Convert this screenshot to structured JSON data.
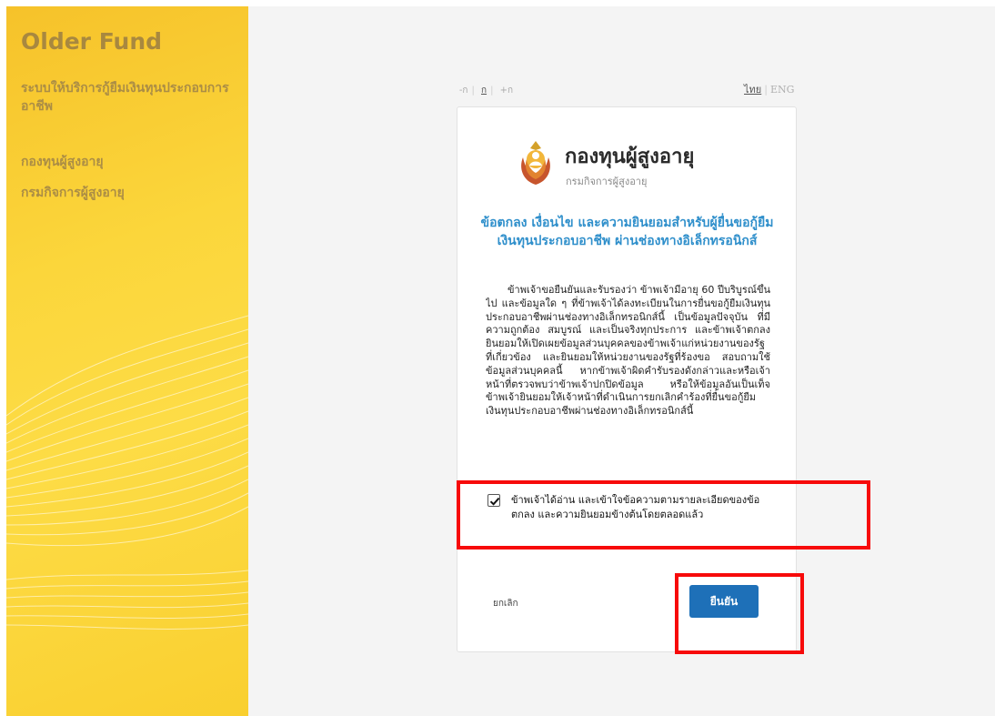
{
  "sidebar": {
    "brand": "Older Fund",
    "system_title": "ระบบให้บริการกู้ยืมเงินทุนประกอบการอาชีพ",
    "links": [
      "กองทุนผู้สูงอายุ",
      "กรมกิจการผู้สูงอายุ"
    ]
  },
  "toolbar": {
    "font_smaller": "-ก",
    "font_normal": "ก",
    "font_larger": "+ก",
    "lang_thai": "ไทย",
    "lang_eng": "ENG"
  },
  "card": {
    "org_name": "กองทุนผู้สูงอายุ",
    "org_sub": "กรมกิจการผู้สูงอายุ",
    "terms_title": "ข้อตกลง เงื่อนไข และความยินยอมสำหรับผู้ยื่นขอกู้ยืมเงินทุนประกอบอาชีพ ผ่านช่องทางอิเล็กทรอนิกส์",
    "terms_body": "ข้าพเจ้าขอยืนยันและรับรองว่า ข้าพเจ้ามีอายุ 60 ปีบริบูรณ์ขึ้นไป และข้อมูลใด ๆ ที่ข้าพเจ้าได้ลงทะเบียนในการยื่นขอกู้ยืมเงินทุนประกอบอาชีพผ่านช่องทางอิเล็กทรอนิกส์นี้ เป็นข้อมูลปัจจุบัน ที่มีความถูกต้อง สมบูรณ์ และเป็นจริงทุกประการ และข้าพเจ้าตกลงยินยอมให้เปิดเผยข้อมูลส่วนบุคคลของข้าพเจ้าแก่หน่วยงานของรัฐที่เกี่ยวข้อง และยินยอมให้หน่วยงานของรัฐที่ร้องขอ สอบถามใช้ข้อมูลส่วนบุคคลนี้ หากข้าพเจ้าผิดคำรับรองดังกล่าวและหรือเจ้าหน้าที่ตรวจพบว่าข้าพเจ้าปกปิดข้อมูล หรือให้ข้อมูลอันเป็นเท็จ ข้าพเจ้ายินยอมให้เจ้าหน้าที่ดำเนินการยกเลิกคำร้องที่ยื่นขอกู้ยืมเงินทุนประกอบอาชีพผ่านช่องทางอิเล็กทรอนิกส์นี้",
    "agree_checked": true,
    "agree_label": "ข้าพเจ้าได้อ่าน และเข้าใจข้อความตามรายละเอียดของข้อตกลง และความยินยอมข้างต้นโดยตลอดแล้ว",
    "cancel_label": "ยกเลิก",
    "confirm_label": "ยืนยัน"
  },
  "colors": {
    "brand_yellow": "#fbd63b",
    "title_blue": "#2f8fcb",
    "button_blue": "#1e70b8",
    "highlight_red": "#f70a0a"
  }
}
